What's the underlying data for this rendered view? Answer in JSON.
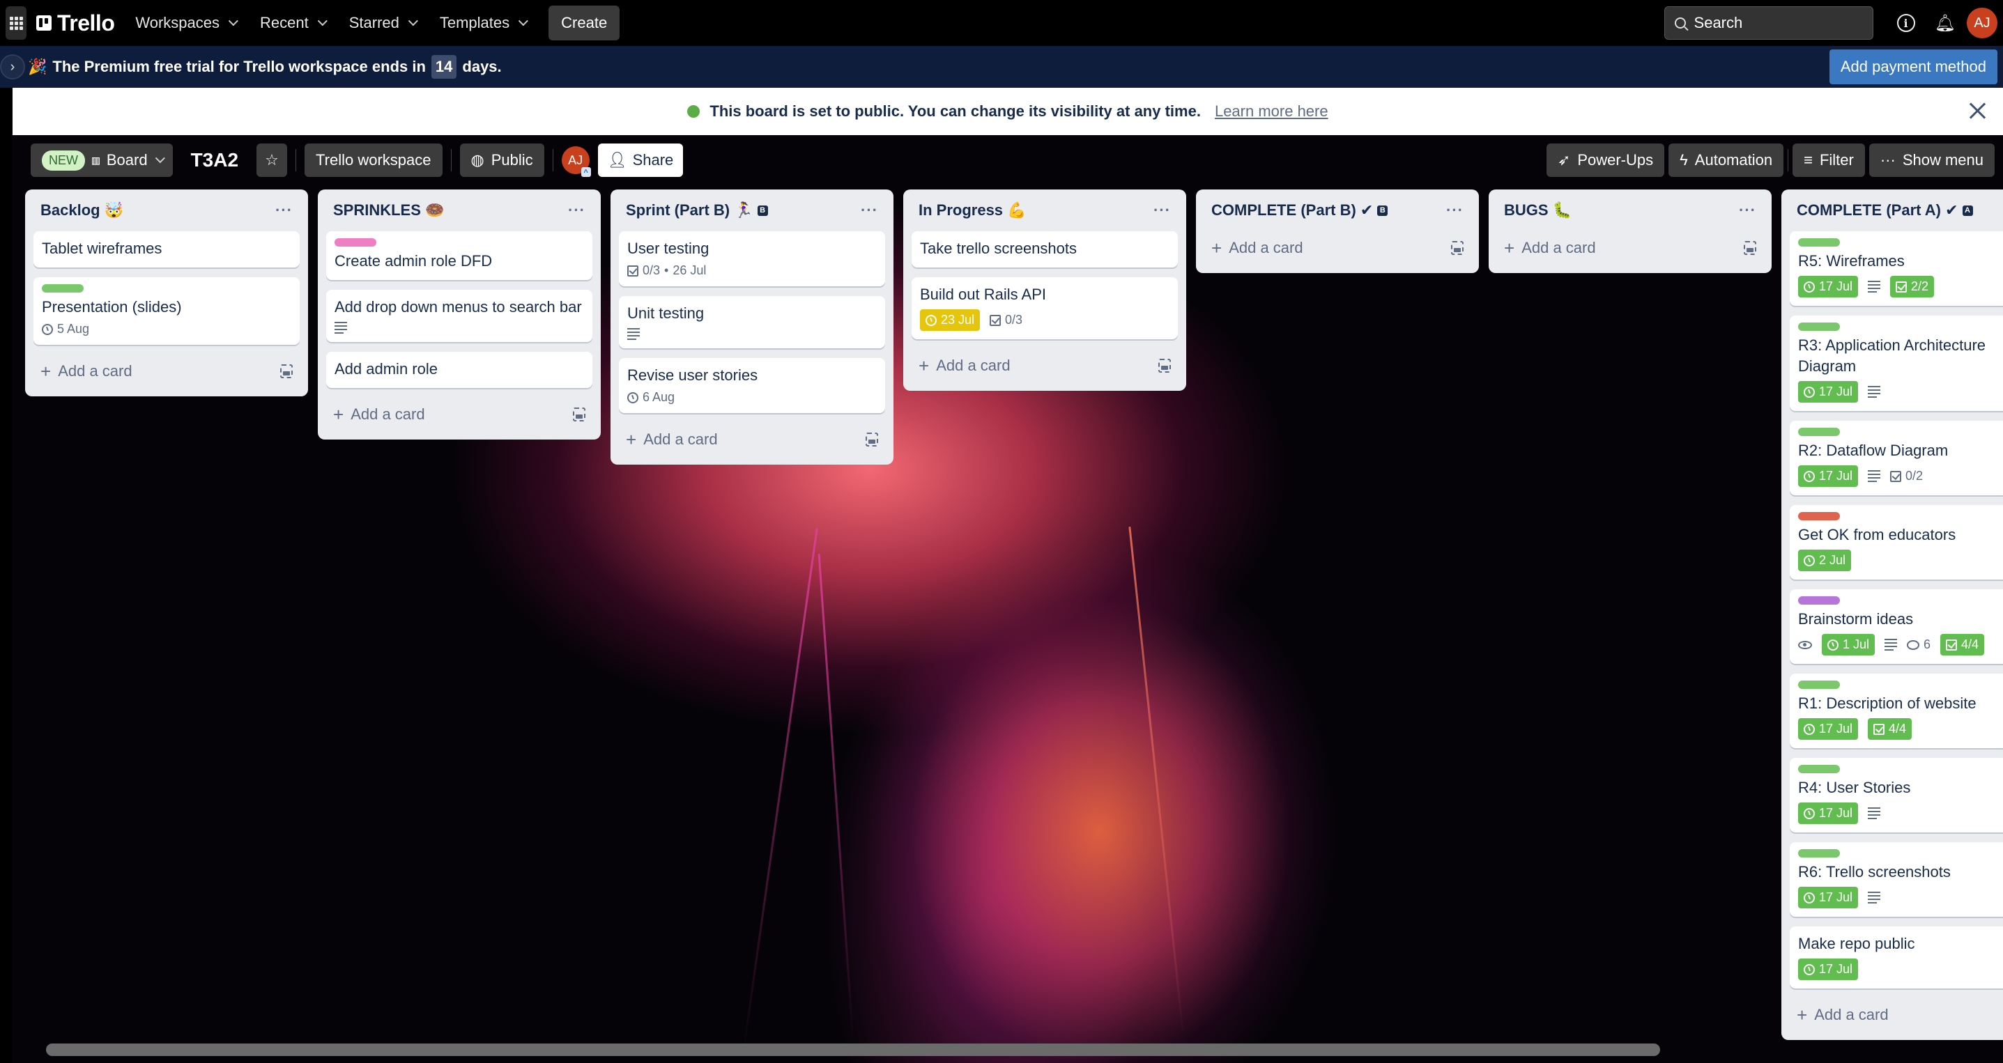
{
  "topnav": {
    "logo": "Trello",
    "menu": [
      {
        "label": "Workspaces"
      },
      {
        "label": "Recent"
      },
      {
        "label": "Starred"
      },
      {
        "label": "Templates"
      }
    ],
    "create_label": "Create",
    "search_placeholder": "Search",
    "avatar_initials": "AJ"
  },
  "trial_banner": {
    "emoji": "🎉",
    "text_before": "The Premium free trial for Trello workspace ends in",
    "days": "14",
    "text_after": "days.",
    "button_label": "Add payment method"
  },
  "public_notice": {
    "text": "This board is set to public. You can change its visibility at any time.",
    "link": "Learn more here"
  },
  "board_header": {
    "new_badge": "NEW",
    "view_label": "Board",
    "title": "T3A2",
    "workspace_label": "Trello workspace",
    "visibility_label": "Public",
    "member_initials": "AJ",
    "share_label": "Share",
    "powerups_label": "Power-Ups",
    "automation_label": "Automation",
    "filter_label": "Filter",
    "menu_label": "Show menu"
  },
  "colors": {
    "label_green": "#7bc86c",
    "label_pink": "#ef7ec5",
    "label_red": "#e0634d",
    "label_purple": "#b675d8",
    "badge_green": "#61bd4f",
    "badge_yellow": "#e6c60d",
    "accent_blue": "#3b78c2"
  },
  "add_card_label": "Add a card",
  "lists": [
    {
      "title": "Backlog 🤯",
      "badge": "",
      "cards": [
        {
          "title": "Tablet wireframes"
        },
        {
          "title": "Presentation (slides)",
          "label": "green",
          "due": "5 Aug"
        }
      ]
    },
    {
      "title": "SPRINKLES 🍩",
      "badge": "",
      "cards": [
        {
          "title": "Create admin role DFD",
          "label": "pink"
        },
        {
          "title": "Add drop down menus to search bar",
          "description": true
        },
        {
          "title": "Add admin role"
        }
      ]
    },
    {
      "title": "Sprint (Part B) 🏃‍♀️",
      "badge": "B",
      "cards": [
        {
          "title": "User testing",
          "checklist": "0/3",
          "due_inline": "26 Jul"
        },
        {
          "title": "Unit testing",
          "description": true
        },
        {
          "title": "Revise user stories",
          "due": "6 Aug"
        }
      ]
    },
    {
      "title": "In Progress 💪",
      "badge": "",
      "cards": [
        {
          "title": "Take trello screenshots"
        },
        {
          "title": "Build out Rails API",
          "due": "23 Jul",
          "due_status": "yellow",
          "checklist": "0/3"
        }
      ]
    },
    {
      "title": "COMPLETE (Part B) ✔",
      "badge": "B",
      "cards": []
    },
    {
      "title": "BUGS 🐛",
      "badge": "",
      "cards": []
    },
    {
      "title": "COMPLETE (Part A) ✔",
      "badge": "A",
      "cards": [
        {
          "title": "R5: Wireframes",
          "label": "green",
          "due": "17 Jul",
          "due_status": "green",
          "description": true,
          "checklist": "2/2",
          "checklist_status": "green"
        },
        {
          "title": "R3: Application Architecture Diagram",
          "label": "green",
          "due": "17 Jul",
          "due_status": "green",
          "description": true
        },
        {
          "title": "R2: Dataflow Diagram",
          "label": "green",
          "due": "17 Jul",
          "due_status": "green",
          "description": true,
          "checklist": "0/2"
        },
        {
          "title": "Get OK from educators",
          "label": "red",
          "due": "2 Jul",
          "due_status": "green"
        },
        {
          "title": "Brainstorm ideas",
          "label": "purple",
          "watching": true,
          "due": "1 Jul",
          "due_status": "green",
          "description": true,
          "comments": "6",
          "checklist": "4/4",
          "checklist_status": "green"
        },
        {
          "title": "R1: Description of website",
          "label": "green",
          "due": "17 Jul",
          "due_status": "green",
          "checklist": "4/4",
          "checklist_status": "green"
        },
        {
          "title": "R4: User Stories",
          "label": "green",
          "due": "17 Jul",
          "due_status": "green",
          "description": true
        },
        {
          "title": "R6: Trello screenshots",
          "label": "green",
          "due": "17 Jul",
          "due_status": "green",
          "description": true
        },
        {
          "title": "Make repo public",
          "due": "17 Jul",
          "due_status": "green"
        }
      ]
    }
  ]
}
